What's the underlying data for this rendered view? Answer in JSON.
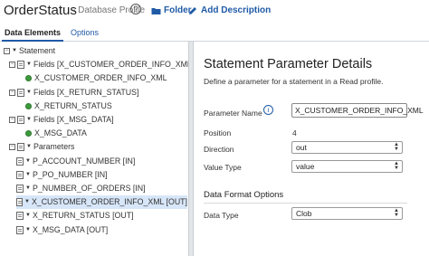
{
  "header": {
    "title": "OrderStatus",
    "subtitle": "- Database Profile",
    "help_icon": "?",
    "folder_label": "Folder",
    "add_description_label": "Add Description"
  },
  "tabs": [
    {
      "label": "Data Elements",
      "active": true
    },
    {
      "label": "Options",
      "active": false
    }
  ],
  "tree": {
    "rows": [
      {
        "expander": "−",
        "label": "Statement",
        "kind": "node",
        "selected": false
      },
      {
        "expander": "−",
        "label": "Fields [X_CUSTOMER_ORDER_INFO_XML]",
        "kind": "doc",
        "selected": false
      },
      {
        "expander": "",
        "label": "X_CUSTOMER_ORDER_INFO_XML",
        "kind": "leaf",
        "selected": false
      },
      {
        "expander": "−",
        "label": "Fields [X_RETURN_STATUS]",
        "kind": "doc",
        "selected": false
      },
      {
        "expander": "",
        "label": "X_RETURN_STATUS",
        "kind": "leaf",
        "selected": false
      },
      {
        "expander": "−",
        "label": "Fields [X_MSG_DATA]",
        "kind": "doc",
        "selected": false
      },
      {
        "expander": "",
        "label": "X_MSG_DATA",
        "kind": "leaf",
        "selected": false
      },
      {
        "expander": "−",
        "label": "Parameters",
        "kind": "node",
        "selected": false
      },
      {
        "expander": "",
        "label": "P_ACCOUNT_NUMBER [IN]",
        "kind": "param",
        "selected": false
      },
      {
        "expander": "",
        "label": "P_PO_NUMBER [IN]",
        "kind": "param",
        "selected": false
      },
      {
        "expander": "",
        "label": "P_NUMBER_OF_ORDERS [IN]",
        "kind": "param",
        "selected": false
      },
      {
        "expander": "",
        "label": "X_CUSTOMER_ORDER_INFO_XML [OUT]",
        "kind": "param",
        "selected": true
      },
      {
        "expander": "",
        "label": "X_RETURN_STATUS [OUT]",
        "kind": "param",
        "selected": false
      },
      {
        "expander": "",
        "label": "X_MSG_DATA [OUT]",
        "kind": "param",
        "selected": false
      }
    ]
  },
  "details": {
    "title": "Statement Parameter Details",
    "description": "Define a parameter for a statement in a Read profile.",
    "parameter_name_label": "Parameter Name",
    "parameter_name_value": "X_CUSTOMER_ORDER_INFO_XML",
    "info_icon": "i",
    "position_label": "Position",
    "position_value": "4",
    "direction_label": "Direction",
    "direction_value": "out",
    "value_type_label": "Value Type",
    "value_type_value": "value",
    "data_format_section": "Data Format Options",
    "data_type_label": "Data Type",
    "data_type_value": "Clob"
  },
  "colors": {
    "link_blue": "#1f5aa6",
    "selected_row": "#d7e6f8",
    "field_green": "#3d9a3d"
  }
}
